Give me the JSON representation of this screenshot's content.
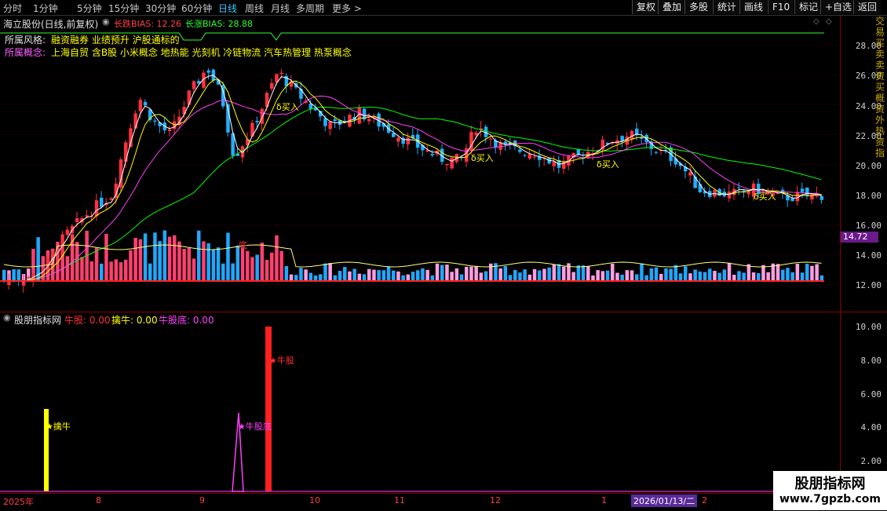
{
  "toolbar": {
    "timeframes": [
      "分时",
      "1分钟",
      "5分钟",
      "15分钟",
      "30分钟",
      "60分钟",
      "日线",
      "周线",
      "月线",
      "多周期",
      "更多 >"
    ],
    "active_timeframe": "日线",
    "buttons": [
      "复权",
      "叠加",
      "多股",
      "统计",
      "画线",
      "F10",
      "标记",
      "+自选",
      "返回"
    ]
  },
  "stock": {
    "title": "海立股份(日线,前复权)",
    "bias_short_label": "长跌BIAS: 12.26",
    "bias_long_label": "长涨BIAS: 28.88",
    "style_label": "所属风格:",
    "style_value": "融资融券 业绩预升 沪股通标的",
    "concept_label": "所属概念:",
    "concept_value": "上海自贸 含B股 小米概念 地热能 光刻机 冷链物流 汽车热管理 热泵概念",
    "current_price_tag": "14.72",
    "buy_marks": [
      "δ买入",
      "δ买入",
      "δ买入",
      "δ买入"
    ],
    "small_mark": "底"
  },
  "price_axis": {
    "ticks": [
      "28.00",
      "26.00",
      "24.00",
      "22.00",
      "20.00",
      "18.00",
      "16.00",
      "14.00",
      "12.00"
    ]
  },
  "indicator": {
    "name": "股朋指标网",
    "values": [
      {
        "label": "牛股: 0.00",
        "color": "#ff3030"
      },
      {
        "label": "擒牛: 0.00",
        "color": "#ffff00"
      },
      {
        "label": "牛股底: 0.00",
        "color": "#ff40ff"
      }
    ],
    "signals": [
      {
        "text": "★擒牛",
        "color": "#ffff00"
      },
      {
        "text": "★牛股底",
        "color": "#ff40ff"
      },
      {
        "text": "★牛股",
        "color": "#ff3030"
      }
    ],
    "axis_ticks": [
      "10.00",
      "8.00",
      "6.00",
      "4.00",
      "2.00"
    ]
  },
  "date_axis": {
    "labels": [
      "2025年",
      "8",
      "9",
      "10",
      "11",
      "12",
      "1",
      "2"
    ],
    "cursor_date": "2026/01/13/二"
  },
  "right_strip": "交易买卖卖资买概资外热资指",
  "watermark": {
    "title": "股朋指标网",
    "url": "www.7gpzb.com"
  },
  "colors": {
    "up": "#ff3040",
    "down": "#20b0ff",
    "ma5": "#ffffff",
    "ma10": "#ffff00",
    "ma20": "#ff40ff",
    "ma60": "#00ff00",
    "grid": "#8b0000"
  }
}
